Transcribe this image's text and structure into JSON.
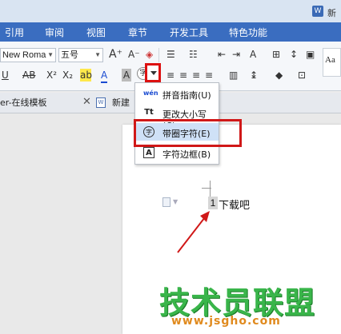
{
  "window": {
    "title_fragment": "新",
    "app_icon": "W"
  },
  "menu": {
    "items": [
      "引用",
      "审阅",
      "视图",
      "章节",
      "开发工具",
      "特色功能"
    ]
  },
  "ribbon": {
    "font_name": "New Roma",
    "font_size": "五号",
    "grow_font": "A⁺",
    "shrink_font": "A⁻",
    "underline": "U",
    "strike": "AB",
    "superscript": "X²",
    "subscript": "X₂",
    "style_preview": "Aa"
  },
  "doc_tabs": {
    "template_tab": "er-在线模板",
    "new_tab": "新建"
  },
  "dropdown": {
    "items": [
      {
        "icon": "pinyin-guide-icon",
        "label": "拼音指南(U)"
      },
      {
        "icon": "change-case-icon",
        "label": "更改大小写(C)"
      },
      {
        "icon": "enclosed-char-icon",
        "label": "带圈字符(E)",
        "highlighted": true
      },
      {
        "icon": "char-border-icon",
        "label": "字符边框(B)"
      }
    ]
  },
  "document": {
    "enclosed_char": "1",
    "text": "下载吧"
  },
  "watermark": {
    "title": "技术员联盟",
    "url": "www.jsgho.com"
  },
  "colors": {
    "menubar": "#3a6dc0",
    "highlight_frame": "#d01818",
    "arrow": "#d01818",
    "watermark_green": "#39b54a",
    "watermark_orange": "#e08a1e"
  }
}
